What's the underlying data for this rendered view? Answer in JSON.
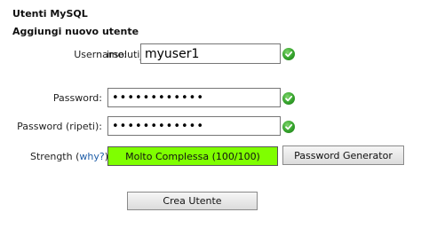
{
  "section": {
    "title": "Utenti MySQL",
    "subtitle": "Aggiungi nuovo utente"
  },
  "form": {
    "username_label": "Username:",
    "username_prefix": "irsoluti_",
    "username_value": "myuser1",
    "password_label": "Password:",
    "password_value": "••••••••••••",
    "password_repeat_label": "Password (ripeti):",
    "password_repeat_value": "••••••••••••",
    "strength_label_prefix": "Strength (",
    "strength_link": "why?",
    "strength_label_suffix": "):",
    "strength_value": "Molto Complessa (100/100)",
    "strength_percent": 100,
    "generator_button": "Password Generator",
    "submit_button": "Crea Utente"
  },
  "colors": {
    "strength_fill": "#7fff00",
    "valid_check": "#34a22b",
    "link": "#1f5ea8"
  },
  "icons": {
    "valid": "check-circle-icon"
  }
}
